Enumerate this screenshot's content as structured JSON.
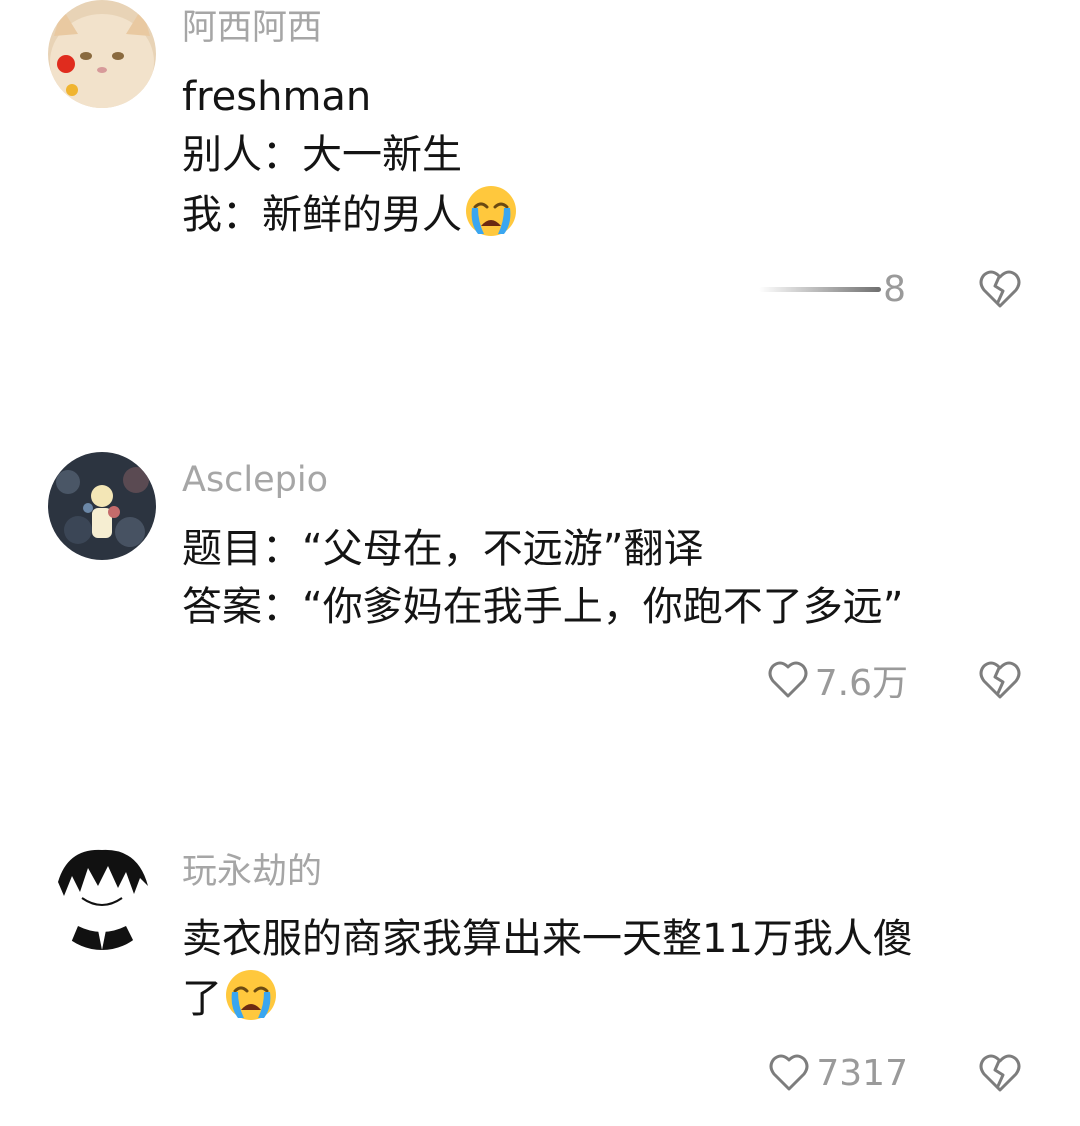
{
  "comments": [
    {
      "username": "阿西阿西",
      "lines": [
        "freshman",
        "别人：大一新生",
        "我：新鲜的男人"
      ],
      "trailing_emoji": "loudly-crying-face-emoji",
      "like_count": "8",
      "like_icon": "heart-outline-icon",
      "dislike_icon": "broken-heart-icon"
    },
    {
      "username": "Asclepio",
      "lines": [
        "题目：“父母在，不远游”翻译",
        "答案：“你爹妈在我手上，你跑不了多远”"
      ],
      "like_count": "7.6万",
      "like_icon": "heart-outline-icon",
      "dislike_icon": "broken-heart-icon"
    },
    {
      "username": "玩永劫的",
      "lines": [
        "卖衣服的商家我算出来一天整11万我人傻",
        "了"
      ],
      "trailing_emoji": "loudly-crying-face-emoji",
      "like_count": "7317",
      "like_icon": "heart-outline-icon",
      "dislike_icon": "broken-heart-icon"
    }
  ],
  "colors": {
    "username": "#a6a6a6",
    "body_text": "#141414",
    "count": "#9a9a9a",
    "icon_stroke": "#7d7d7d",
    "emoji_face": "#ffc83d",
    "emoji_tears": "#3aa6f0"
  }
}
